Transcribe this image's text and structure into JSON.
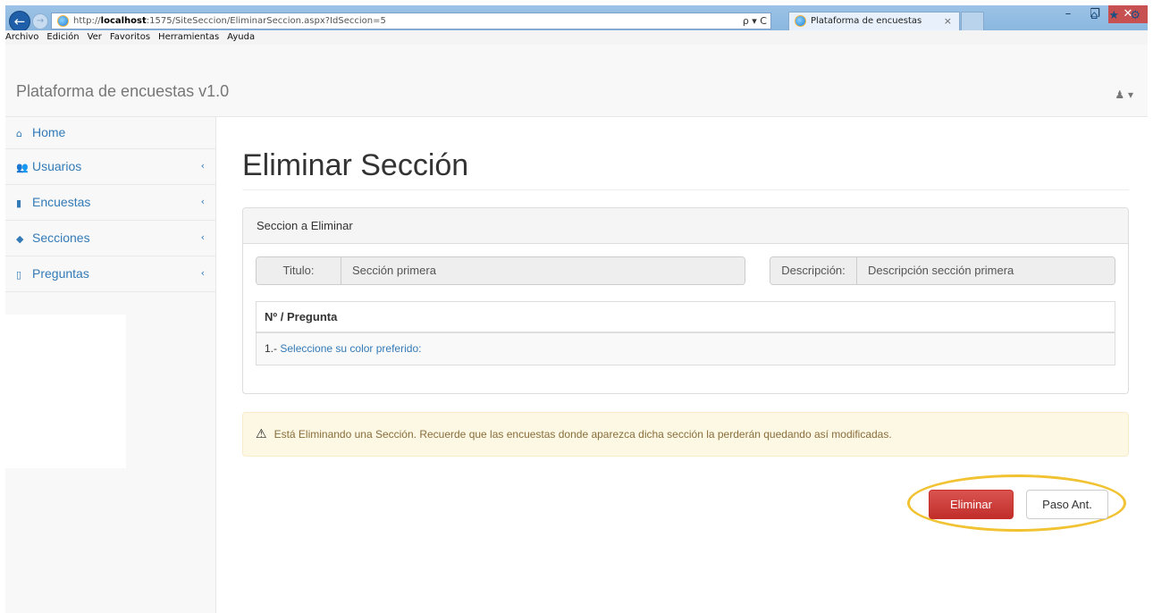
{
  "browser": {
    "url_prefix": "http://",
    "url_host": "localhost",
    "url_rest": ":1575/SiteSeccion/EliminarSeccion.aspx?IdSeccion=5",
    "search_refresh": "ρ ▾ C",
    "tab_title": "Plataforma de encuestas",
    "tab_close": "×",
    "win_minimize": "–",
    "win_restore": "❐",
    "win_close": "✕",
    "toolbar_icons": "⌂ ★ ⚙",
    "menu": [
      "Archivo",
      "Edición",
      "Ver",
      "Favoritos",
      "Herramientas",
      "Ayuda"
    ]
  },
  "navbar": {
    "brand": "Plataforma de encuestas v1.0",
    "user_icon": "♟ ▾"
  },
  "sidebar": {
    "items": [
      {
        "label": "Home",
        "icon": "home-icon",
        "glyph": "⌂",
        "chevron": ""
      },
      {
        "label": "Usuarios",
        "icon": "users-icon",
        "glyph": "👥",
        "chevron": "‹"
      },
      {
        "label": "Encuestas",
        "icon": "bookmark-icon",
        "glyph": "▮",
        "chevron": "‹"
      },
      {
        "label": "Secciones",
        "icon": "tags-icon",
        "glyph": "◆",
        "chevron": "‹"
      },
      {
        "label": "Preguntas",
        "icon": "bookmark-outline-icon",
        "glyph": "▯",
        "chevron": "‹"
      }
    ]
  },
  "main": {
    "title": "Eliminar Sección",
    "panel_heading": "Seccion a Eliminar",
    "titulo_label": "Titulo:",
    "titulo_value": "Sección primera",
    "descripcion_label": "Descripción:",
    "descripcion_value": "Descripción sección primera",
    "table_header": "Nº / Pregunta",
    "rows": [
      {
        "num": "1.-",
        "question": "Seleccione su color preferido:"
      }
    ],
    "alert_icon": "⚠",
    "alert_text": "Está Eliminando una Sección. Recuerde que las encuestas donde aparezca dicha sección la perderán quedando así modificadas.",
    "delete_button": "Eliminar",
    "prev_button": "Paso Ant."
  },
  "colors": {
    "primary": "#337ab7",
    "danger": "#d9534f",
    "warning_bg": "#fcf8e3",
    "highlight": "#f1c232"
  }
}
